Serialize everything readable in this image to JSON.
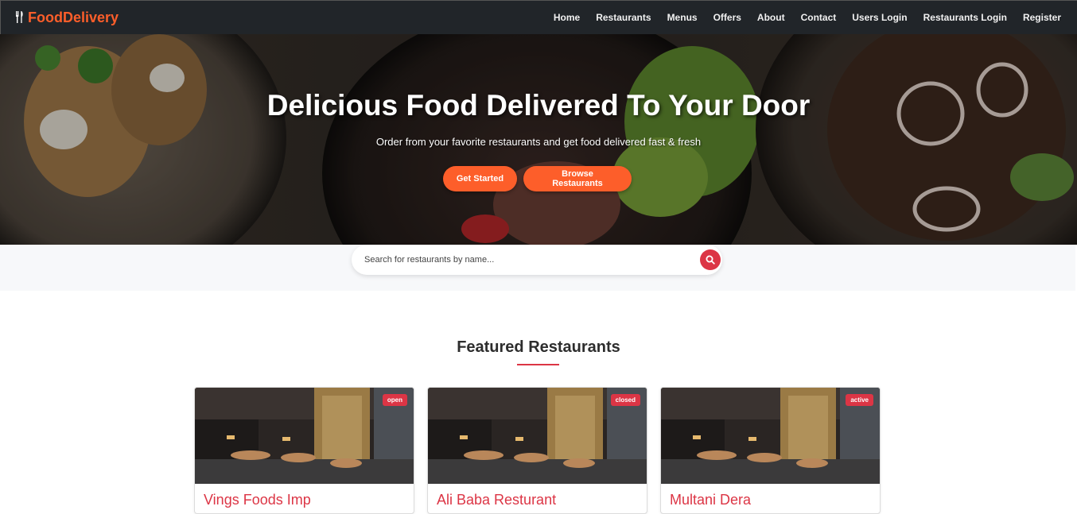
{
  "brand": {
    "name": "FoodDelivery",
    "icon": "utensils-icon",
    "color": "#fd5e2a"
  },
  "nav": {
    "items": [
      "Home",
      "Restaurants",
      "Menus",
      "Offers",
      "About",
      "Contact",
      "Users Login",
      "Restaurants Login",
      "Register"
    ]
  },
  "hero": {
    "title": "Delicious Food Delivered To Your Door",
    "subtitle": "Order from your favorite restaurants and get food delivered fast & fresh",
    "primary_button": "Get Started",
    "secondary_button": "Browse Restaurants"
  },
  "search": {
    "placeholder": "Search for restaurants by name...",
    "icon": "search-icon"
  },
  "featured": {
    "title": "Featured Restaurants",
    "cards": [
      {
        "name": "Vings Foods Imp",
        "status": "open"
      },
      {
        "name": "Ali Baba Resturant",
        "status": "closed"
      },
      {
        "name": "Multani Dera",
        "status": "active"
      }
    ]
  },
  "colors": {
    "accent": "#fd5e2a",
    "danger": "#dc3545",
    "navbar": "#212529"
  }
}
